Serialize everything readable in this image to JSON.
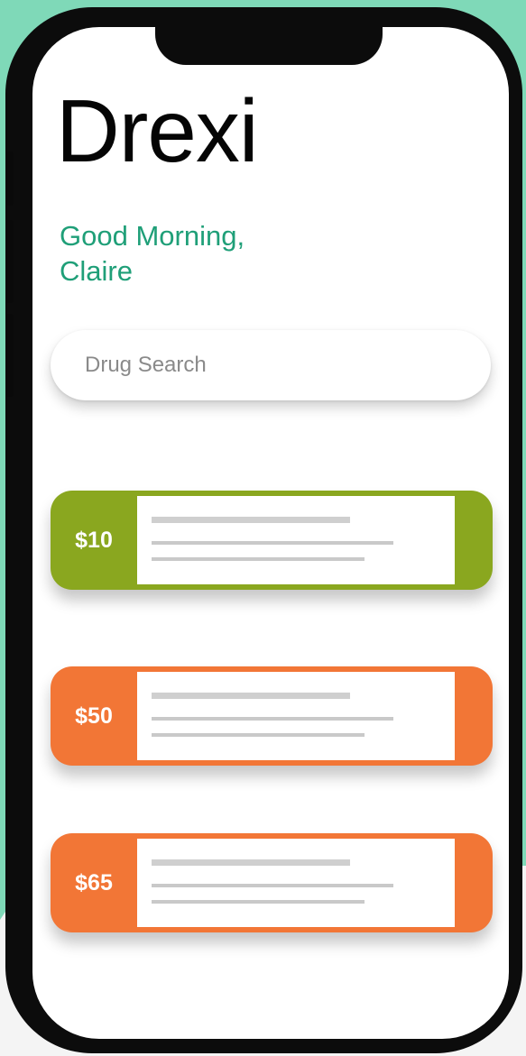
{
  "app": {
    "title": "Drexi"
  },
  "greeting": {
    "line1": "Good Morning,",
    "line2": "Claire"
  },
  "search": {
    "placeholder": "Drug Search"
  },
  "price_cards": [
    {
      "price": "$10",
      "color": "#8aa71f"
    },
    {
      "price": "$50",
      "color": "#f27636"
    },
    {
      "price": "$65",
      "color": "#f27636"
    }
  ],
  "colors": {
    "background": "#7fd9b8",
    "accent_green_text": "#1f9f78",
    "phone_frame": "#0c0c0c"
  }
}
